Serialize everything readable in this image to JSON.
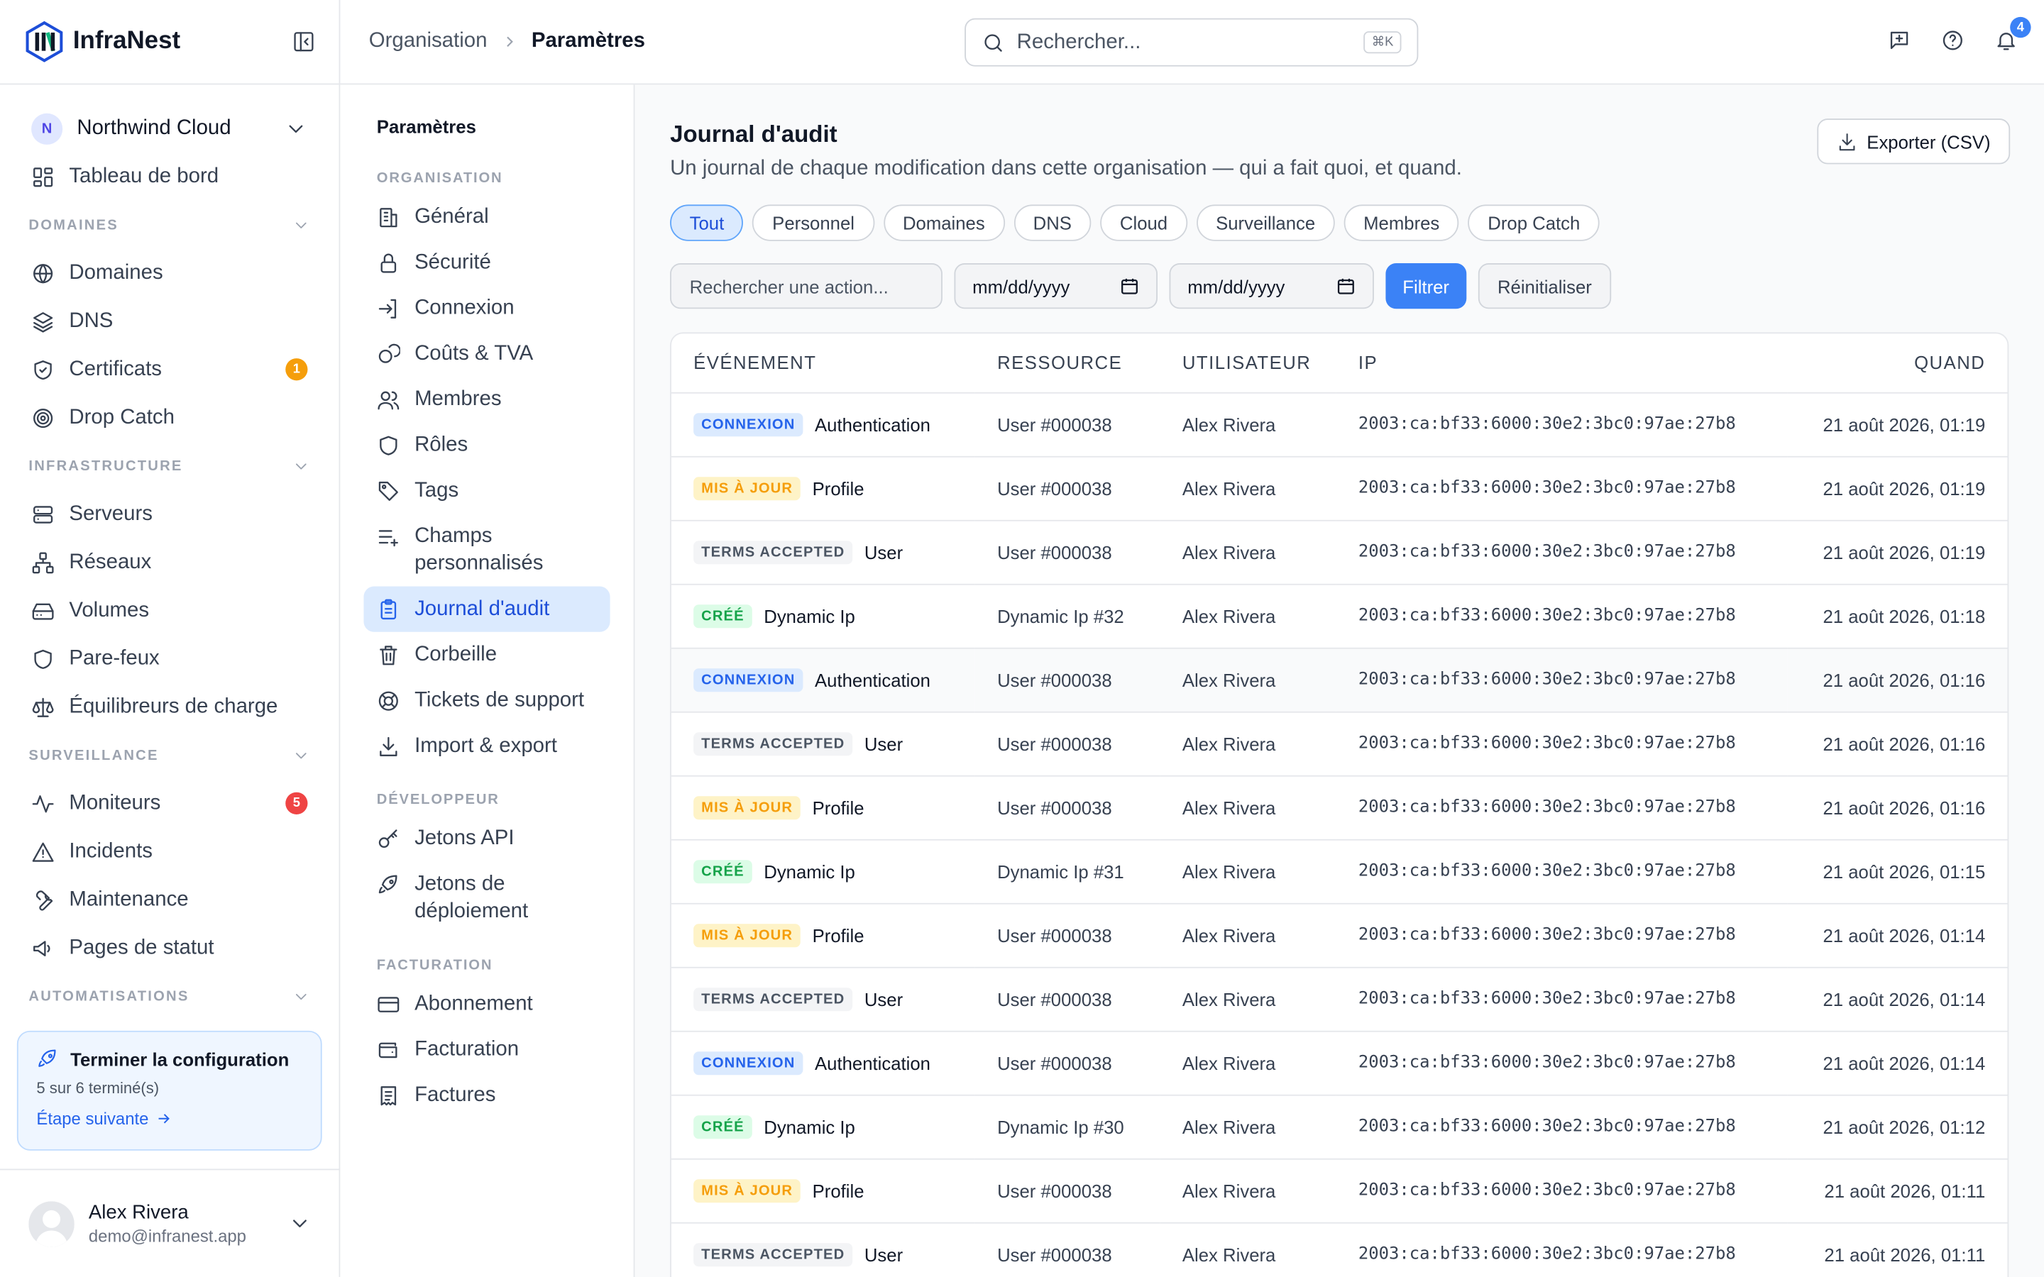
{
  "brand": {
    "name": "InfraNest"
  },
  "org": {
    "initial": "N",
    "name": "Northwind Cloud"
  },
  "sidebar": {
    "dashboard": "Tableau de bord",
    "sections": [
      {
        "title": "DOMAINES",
        "items": [
          {
            "label": "Domaines",
            "icon": "globe-icon"
          },
          {
            "label": "DNS",
            "icon": "layers-icon"
          },
          {
            "label": "Certificats",
            "icon": "shield-check-icon",
            "badge": "1",
            "badge_color": "#f59e0b"
          },
          {
            "label": "Drop Catch",
            "icon": "target-icon"
          }
        ]
      },
      {
        "title": "INFRASTRUCTURE",
        "items": [
          {
            "label": "Serveurs",
            "icon": "server-icon"
          },
          {
            "label": "Réseaux",
            "icon": "network-icon"
          },
          {
            "label": "Volumes",
            "icon": "hard-drive-icon"
          },
          {
            "label": "Pare-feux",
            "icon": "shield-icon"
          },
          {
            "label": "Équilibreurs de charge",
            "icon": "scale-icon"
          }
        ]
      },
      {
        "title": "SURVEILLANCE",
        "items": [
          {
            "label": "Moniteurs",
            "icon": "activity-icon",
            "badge": "5",
            "badge_color": "#ef4444"
          },
          {
            "label": "Incidents",
            "icon": "alert-icon"
          },
          {
            "label": "Maintenance",
            "icon": "wrench-icon"
          },
          {
            "label": "Pages de statut",
            "icon": "megaphone-icon"
          }
        ]
      },
      {
        "title": "AUTOMATISATIONS",
        "items": []
      }
    ]
  },
  "setup": {
    "title": "Terminer la configuration",
    "progress": "5 sur 6 terminé(s)",
    "next": "Étape suivante"
  },
  "user": {
    "name": "Alex Rivera",
    "email": "demo@infranest.app"
  },
  "breadcrumb": {
    "parent": "Organisation",
    "current": "Paramètres"
  },
  "search": {
    "placeholder": "Rechercher...",
    "shortcut": "⌘K"
  },
  "notifications": {
    "count": "4"
  },
  "subnav": {
    "title": "Paramètres",
    "sections": [
      {
        "title": "ORGANISATION",
        "items": [
          {
            "label": "Général",
            "icon": "building-icon"
          },
          {
            "label": "Sécurité",
            "icon": "lock-icon"
          },
          {
            "label": "Connexion",
            "icon": "login-icon"
          },
          {
            "label": "Coûts & TVA",
            "icon": "coins-icon"
          },
          {
            "label": "Membres",
            "icon": "users-icon"
          },
          {
            "label": "Rôles",
            "icon": "shield-icon"
          },
          {
            "label": "Tags",
            "icon": "tag-icon"
          },
          {
            "label": "Champs personnalisés",
            "icon": "list-plus-icon"
          },
          {
            "label": "Journal d'audit",
            "icon": "clipboard-icon",
            "active": true
          },
          {
            "label": "Corbeille",
            "icon": "trash-icon"
          },
          {
            "label": "Tickets de support",
            "icon": "lifebuoy-icon"
          },
          {
            "label": "Import & export",
            "icon": "download-icon"
          }
        ]
      },
      {
        "title": "DÉVELOPPEUR",
        "items": [
          {
            "label": "Jetons API",
            "icon": "key-icon"
          },
          {
            "label": "Jetons de déploiement",
            "icon": "rocket-icon"
          }
        ]
      },
      {
        "title": "FACTURATION",
        "items": [
          {
            "label": "Abonnement",
            "icon": "credit-card-icon"
          },
          {
            "label": "Facturation",
            "icon": "wallet-icon"
          },
          {
            "label": "Factures",
            "icon": "receipt-icon"
          }
        ]
      }
    ]
  },
  "main": {
    "title": "Journal d'audit",
    "description": "Un journal de chaque modification dans cette organisation — qui a fait quoi, et quand.",
    "export_label": "Exporter (CSV)",
    "chips": [
      "Tout",
      "Personnel",
      "Domaines",
      "DNS",
      "Cloud",
      "Surveillance",
      "Membres",
      "Drop Catch"
    ],
    "active_chip": 0,
    "action_placeholder": "Rechercher une action...",
    "date_from": "mm/dd/yyyy",
    "date_to": "mm/dd/yyyy",
    "filter_label": "Filtrer",
    "reset_label": "Réinitialiser"
  },
  "table": {
    "columns": [
      "ÉVÉNEMENT",
      "RESSOURCE",
      "UTILISATEUR",
      "IP",
      "QUAND"
    ],
    "tag_styles": {
      "CONNEXION": {
        "bg": "#dbeafe",
        "fg": "#2563eb"
      },
      "MIS À JOUR": {
        "bg": "#fef3c7",
        "fg": "#f59e0b"
      },
      "TERMS ACCEPTED": {
        "bg": "#f3f4f6",
        "fg": "#4b5563"
      },
      "CRÉÉ": {
        "bg": "#dcfce7",
        "fg": "#16a34a"
      }
    },
    "rows": [
      {
        "tag": "CONNEXION",
        "event": "Authentication",
        "resource": "User #000038",
        "user": "Alex Rivera",
        "ip": "2003:ca:bf33:6000:30e2:3bc0:97ae:27b8",
        "when": "21 août 2026, 01:19"
      },
      {
        "tag": "MIS À JOUR",
        "event": "Profile",
        "resource": "User #000038",
        "user": "Alex Rivera",
        "ip": "2003:ca:bf33:6000:30e2:3bc0:97ae:27b8",
        "when": "21 août 2026, 01:19"
      },
      {
        "tag": "TERMS ACCEPTED",
        "event": "User",
        "resource": "User #000038",
        "user": "Alex Rivera",
        "ip": "2003:ca:bf33:6000:30e2:3bc0:97ae:27b8",
        "when": "21 août 2026, 01:19"
      },
      {
        "tag": "CRÉÉ",
        "event": "Dynamic Ip",
        "resource": "Dynamic Ip #32",
        "user": "Alex Rivera",
        "ip": "2003:ca:bf33:6000:30e2:3bc0:97ae:27b8",
        "when": "21 août 2026, 01:18"
      },
      {
        "tag": "CONNEXION",
        "event": "Authentication",
        "resource": "User #000038",
        "user": "Alex Rivera",
        "ip": "2003:ca:bf33:6000:30e2:3bc0:97ae:27b8",
        "when": "21 août 2026, 01:16",
        "hover": true
      },
      {
        "tag": "TERMS ACCEPTED",
        "event": "User",
        "resource": "User #000038",
        "user": "Alex Rivera",
        "ip": "2003:ca:bf33:6000:30e2:3bc0:97ae:27b8",
        "when": "21 août 2026, 01:16"
      },
      {
        "tag": "MIS À JOUR",
        "event": "Profile",
        "resource": "User #000038",
        "user": "Alex Rivera",
        "ip": "2003:ca:bf33:6000:30e2:3bc0:97ae:27b8",
        "when": "21 août 2026, 01:16"
      },
      {
        "tag": "CRÉÉ",
        "event": "Dynamic Ip",
        "resource": "Dynamic Ip #31",
        "user": "Alex Rivera",
        "ip": "2003:ca:bf33:6000:30e2:3bc0:97ae:27b8",
        "when": "21 août 2026, 01:15"
      },
      {
        "tag": "MIS À JOUR",
        "event": "Profile",
        "resource": "User #000038",
        "user": "Alex Rivera",
        "ip": "2003:ca:bf33:6000:30e2:3bc0:97ae:27b8",
        "when": "21 août 2026, 01:14"
      },
      {
        "tag": "TERMS ACCEPTED",
        "event": "User",
        "resource": "User #000038",
        "user": "Alex Rivera",
        "ip": "2003:ca:bf33:6000:30e2:3bc0:97ae:27b8",
        "when": "21 août 2026, 01:14"
      },
      {
        "tag": "CONNEXION",
        "event": "Authentication",
        "resource": "User #000038",
        "user": "Alex Rivera",
        "ip": "2003:ca:bf33:6000:30e2:3bc0:97ae:27b8",
        "when": "21 août 2026, 01:14"
      },
      {
        "tag": "CRÉÉ",
        "event": "Dynamic Ip",
        "resource": "Dynamic Ip #30",
        "user": "Alex Rivera",
        "ip": "2003:ca:bf33:6000:30e2:3bc0:97ae:27b8",
        "when": "21 août 2026, 01:12"
      },
      {
        "tag": "MIS À JOUR",
        "event": "Profile",
        "resource": "User #000038",
        "user": "Alex Rivera",
        "ip": "2003:ca:bf33:6000:30e2:3bc0:97ae:27b8",
        "when": "21 août 2026, 01:11"
      },
      {
        "tag": "TERMS ACCEPTED",
        "event": "User",
        "resource": "User #000038",
        "user": "Alex Rivera",
        "ip": "2003:ca:bf33:6000:30e2:3bc0:97ae:27b8",
        "when": "21 août 2026, 01:11"
      }
    ]
  }
}
